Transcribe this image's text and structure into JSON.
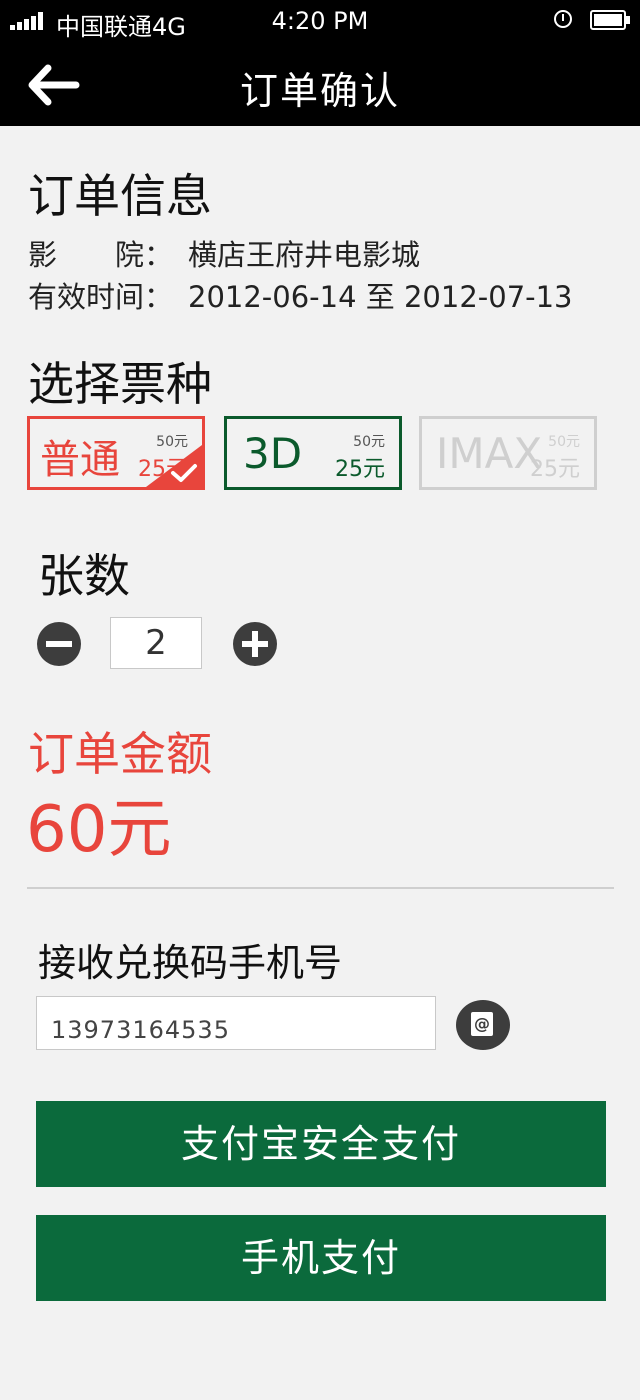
{
  "status_bar": {
    "carrier": "中国联通4G",
    "time": "4:20 PM",
    "icons": [
      "signal-icon",
      "alarm-icon",
      "battery-icon"
    ]
  },
  "nav": {
    "title": "订单确认",
    "back_icon": "back-arrow-icon"
  },
  "order_info": {
    "heading": "订单信息",
    "cinema_label": "影　　院：",
    "cinema_value": "横店王府井电影城",
    "valid_label": "有效时间：",
    "valid_value": "2012-06-14 至 2012-07-13"
  },
  "ticket_types": {
    "heading": "选择票种",
    "items": [
      {
        "name": "普通",
        "original_price": "50元",
        "price": "25元",
        "selected": true
      },
      {
        "name": "3D",
        "original_price": "50元",
        "price": "25元",
        "selected": false
      },
      {
        "name": "IMAX",
        "original_price": "50元",
        "price": "25元",
        "selected": false,
        "disabled": true
      }
    ]
  },
  "quantity": {
    "heading": "张数",
    "value": "2"
  },
  "amount": {
    "label": "订单金额",
    "value": "60元"
  },
  "phone": {
    "label": "接收兑换码手机号",
    "value": "13973164535"
  },
  "buttons": {
    "alipay": "支付宝安全支付",
    "mobile_pay": "手机支付"
  },
  "colors": {
    "accent_red": "#e8453c",
    "accent_green": "#0b6a3c",
    "disabled_gray": "#cfcfcf",
    "bar_black": "#000000"
  }
}
